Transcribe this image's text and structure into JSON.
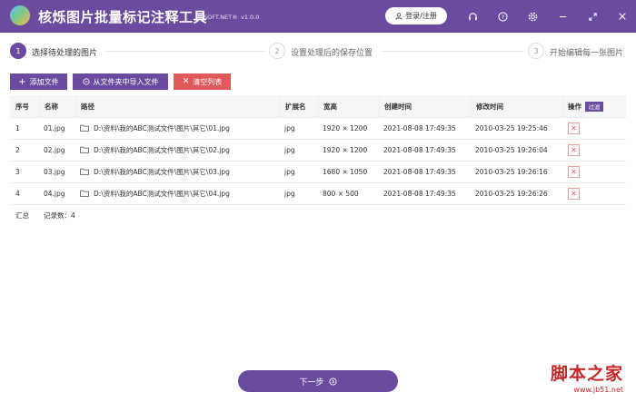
{
  "app": {
    "title": "核烁图片批量标记注释工具",
    "site": "HESOFT.NET®",
    "version": "v1.0.0",
    "login_label": "登录/注册"
  },
  "steps": [
    {
      "num": "1",
      "label": "选择待处理的图片"
    },
    {
      "num": "2",
      "label": "设置处理后的保存位置"
    },
    {
      "num": "3",
      "label": "开始编辑每一张图片"
    }
  ],
  "toolbar": {
    "add_file": "添加文件",
    "import_folder": "从文件夹中导入文件",
    "clear_list": "清空列表"
  },
  "table": {
    "headers": [
      "序号",
      "名称",
      "路径",
      "扩展名",
      "宽高",
      "创建时间",
      "修改时间",
      "操作"
    ],
    "filter_label": "过滤",
    "rows": [
      {
        "index": "1",
        "name": "01.jpg",
        "path": "D:\\资料\\我的ABC测试文件\\图片\\其它\\01.jpg",
        "ext": "jpg",
        "size": "1920 × 1200",
        "created": "2021-08-08 17:49:35",
        "modified": "2010-03-25 19:25:46"
      },
      {
        "index": "2",
        "name": "02.jpg",
        "path": "D:\\资料\\我的ABC测试文件\\图片\\其它\\02.jpg",
        "ext": "jpg",
        "size": "1920 × 1200",
        "created": "2021-08-08 17:49:35",
        "modified": "2010-03-25 19:26:04"
      },
      {
        "index": "3",
        "name": "03.jpg",
        "path": "D:\\资料\\我的ABC测试文件\\图片\\其它\\03.jpg",
        "ext": "jpg",
        "size": "1680 × 1050",
        "created": "2021-08-08 17:49:35",
        "modified": "2010-03-25 19:26:16"
      },
      {
        "index": "4",
        "name": "04.jpg",
        "path": "D:\\资料\\我的ABC测试文件\\图片\\其它\\04.jpg",
        "ext": "jpg",
        "size": "800 × 500",
        "created": "2021-08-08 17:49:35",
        "modified": "2010-03-25 19:26:26"
      }
    ],
    "summary_label": "汇总",
    "record_count": "记录数：4"
  },
  "footer": {
    "next_label": "下一步"
  },
  "watermark": {
    "text": "脚本之家",
    "url": "www.jb51.net"
  },
  "colors": {
    "primary": "#6a4ba0",
    "danger": "#e05a5a"
  }
}
